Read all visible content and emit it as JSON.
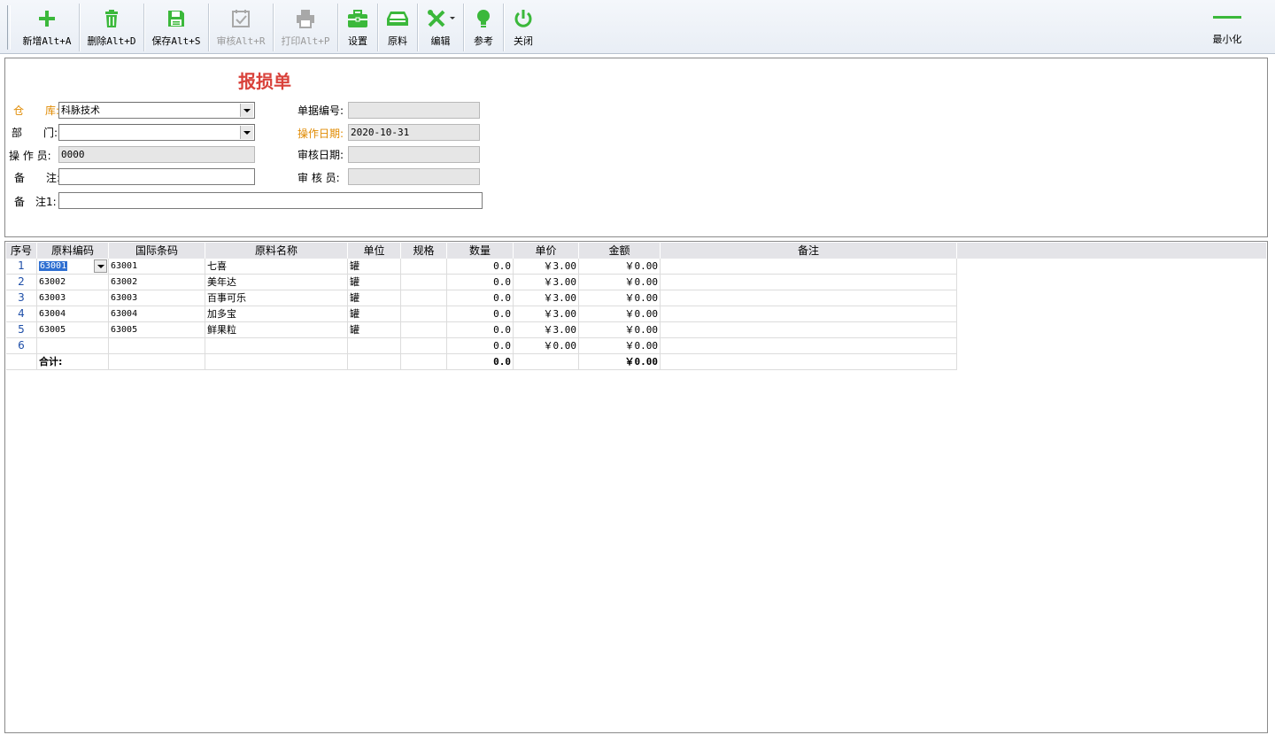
{
  "toolbar": {
    "buttons": [
      {
        "label": "新增Alt+A",
        "icon": "plus-icon",
        "enabled": true
      },
      {
        "label": "删除Alt+D",
        "icon": "trash-icon",
        "enabled": true
      },
      {
        "label": "保存Alt+S",
        "icon": "save-icon",
        "enabled": true
      },
      {
        "label": "审核Alt+R",
        "icon": "audit-icon",
        "enabled": false
      },
      {
        "label": "打印Alt+P",
        "icon": "printer-icon",
        "enabled": false
      },
      {
        "label": "设置",
        "icon": "toolbox-icon",
        "enabled": true
      },
      {
        "label": "原料",
        "icon": "material-tray-icon",
        "enabled": true
      },
      {
        "label": "编辑",
        "icon": "tools-icon",
        "enabled": true
      },
      {
        "label": "参考",
        "icon": "lightbulb-icon",
        "enabled": true
      },
      {
        "label": "关闭",
        "icon": "power-icon",
        "enabled": true
      }
    ],
    "minimize_label": "最小化",
    "accent_color": "#3bb83b"
  },
  "form": {
    "title": "报损单",
    "warehouse": {
      "label": "仓　　库:",
      "value": "科脉技术"
    },
    "department": {
      "label": "部　　门:",
      "value": ""
    },
    "operator": {
      "label": "操 作 员:",
      "value": "0000"
    },
    "remark": {
      "label": "备　　注:",
      "value": ""
    },
    "remark1": {
      "label": "备　注1:",
      "value": ""
    },
    "doc_no": {
      "label": "单据编号:",
      "value": ""
    },
    "op_date": {
      "label": "操作日期:",
      "value": "2020-10-31"
    },
    "audit_date": {
      "label": "审核日期:",
      "value": ""
    },
    "auditor": {
      "label": "审 核 员:",
      "value": ""
    }
  },
  "grid": {
    "columns": [
      "序号",
      "原料编码",
      "国际条码",
      "原料名称",
      "单位",
      "规格",
      "数量",
      "单价",
      "金额",
      "备注"
    ],
    "rows": [
      {
        "idx": "1",
        "code": "63001",
        "barcode": "63001",
        "name": "七喜",
        "unit": "罐",
        "spec": "",
        "qty": "0.0",
        "price": "￥3.00",
        "amount": "￥0.00",
        "remark": ""
      },
      {
        "idx": "2",
        "code": "63002",
        "barcode": "63002",
        "name": "美年达",
        "unit": "罐",
        "spec": "",
        "qty": "0.0",
        "price": "￥3.00",
        "amount": "￥0.00",
        "remark": ""
      },
      {
        "idx": "3",
        "code": "63003",
        "barcode": "63003",
        "name": "百事可乐",
        "unit": "罐",
        "spec": "",
        "qty": "0.0",
        "price": "￥3.00",
        "amount": "￥0.00",
        "remark": ""
      },
      {
        "idx": "4",
        "code": "63004",
        "barcode": "63004",
        "name": "加多宝",
        "unit": "罐",
        "spec": "",
        "qty": "0.0",
        "price": "￥3.00",
        "amount": "￥0.00",
        "remark": ""
      },
      {
        "idx": "5",
        "code": "63005",
        "barcode": "63005",
        "name": "鲜果粒",
        "unit": "罐",
        "spec": "",
        "qty": "0.0",
        "price": "￥3.00",
        "amount": "￥0.00",
        "remark": ""
      },
      {
        "idx": "6",
        "code": "",
        "barcode": "",
        "name": "",
        "unit": "",
        "spec": "",
        "qty": "0.0",
        "price": "￥0.00",
        "amount": "￥0.00",
        "remark": ""
      }
    ],
    "total": {
      "label": "合计:",
      "qty": "0.0",
      "amount": "￥0.00"
    }
  }
}
